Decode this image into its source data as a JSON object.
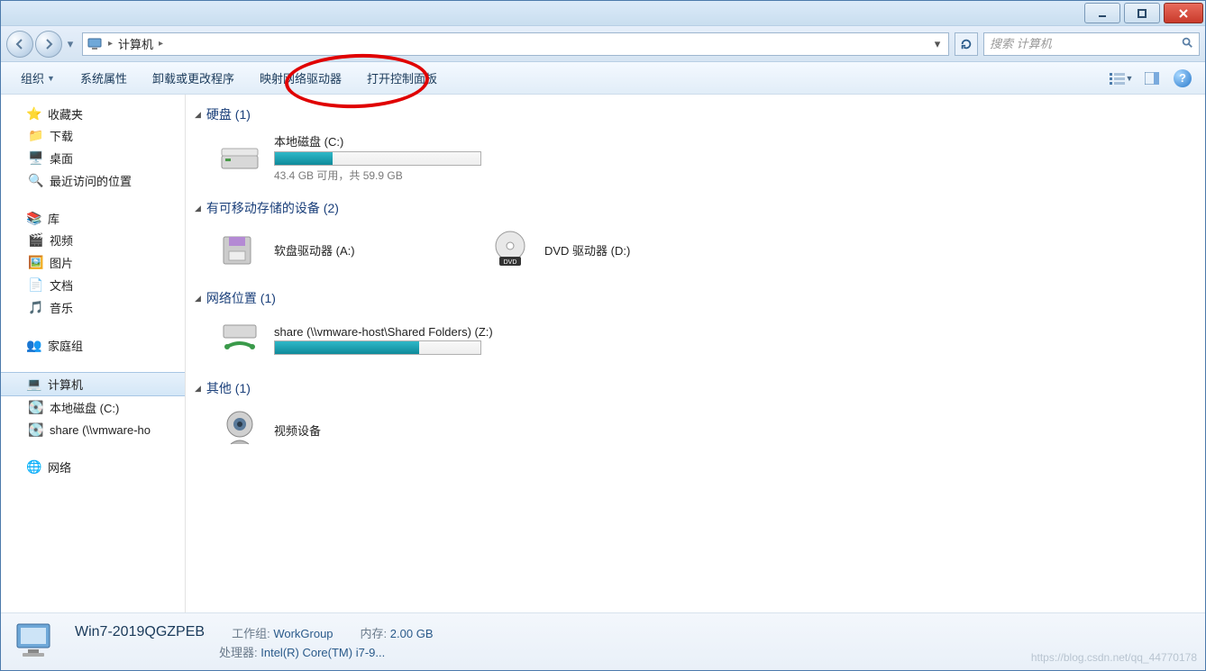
{
  "title_buttons": {
    "min": "minimize",
    "max": "maximize",
    "close": "close"
  },
  "breadcrumb": {
    "root_icon": "computer",
    "item": "计算机"
  },
  "search": {
    "placeholder": "搜索 计算机"
  },
  "toolbar": {
    "organize": "组织",
    "system_props": "系统属性",
    "uninstall": "卸载或更改程序",
    "map_drive": "映射网络驱动器",
    "open_cpl": "打开控制面板"
  },
  "sidebar": {
    "favorites": {
      "label": "收藏夹",
      "items": [
        "下载",
        "桌面",
        "最近访问的位置"
      ]
    },
    "libraries": {
      "label": "库",
      "items": [
        "视频",
        "图片",
        "文档",
        "音乐"
      ]
    },
    "homegroup": {
      "label": "家庭组"
    },
    "computer": {
      "label": "计算机",
      "items": [
        "本地磁盘 (C:)",
        "share (\\\\vmware-ho"
      ]
    },
    "network": {
      "label": "网络"
    }
  },
  "categories": {
    "hdd": {
      "label": "硬盘 (1)",
      "drives": [
        {
          "name": "本地磁盘 (C:)",
          "free_text": "43.4 GB 可用，共 59.9 GB",
          "used_pct": 28
        }
      ]
    },
    "removable": {
      "label": "有可移动存储的设备 (2)",
      "drives": [
        {
          "name": "软盘驱动器 (A:)",
          "type": "floppy"
        },
        {
          "name": "DVD 驱动器 (D:)",
          "type": "dvd"
        }
      ]
    },
    "network": {
      "label": "网络位置 (1)",
      "drives": [
        {
          "name": "share (\\\\vmware-host\\Shared Folders) (Z:)",
          "used_pct": 70
        }
      ]
    },
    "other": {
      "label": "其他 (1)",
      "drives": [
        {
          "name": "视频设备",
          "type": "camera"
        }
      ]
    }
  },
  "details": {
    "title": "Win7-2019QGZPEB",
    "workgroup_lbl": "工作组:",
    "workgroup_val": "WorkGroup",
    "memory_lbl": "内存:",
    "memory_val": "2.00 GB",
    "cpu_lbl": "处理器:",
    "cpu_val": "Intel(R) Core(TM) i7-9..."
  },
  "watermark": "https://blog.csdn.net/qq_44770178"
}
